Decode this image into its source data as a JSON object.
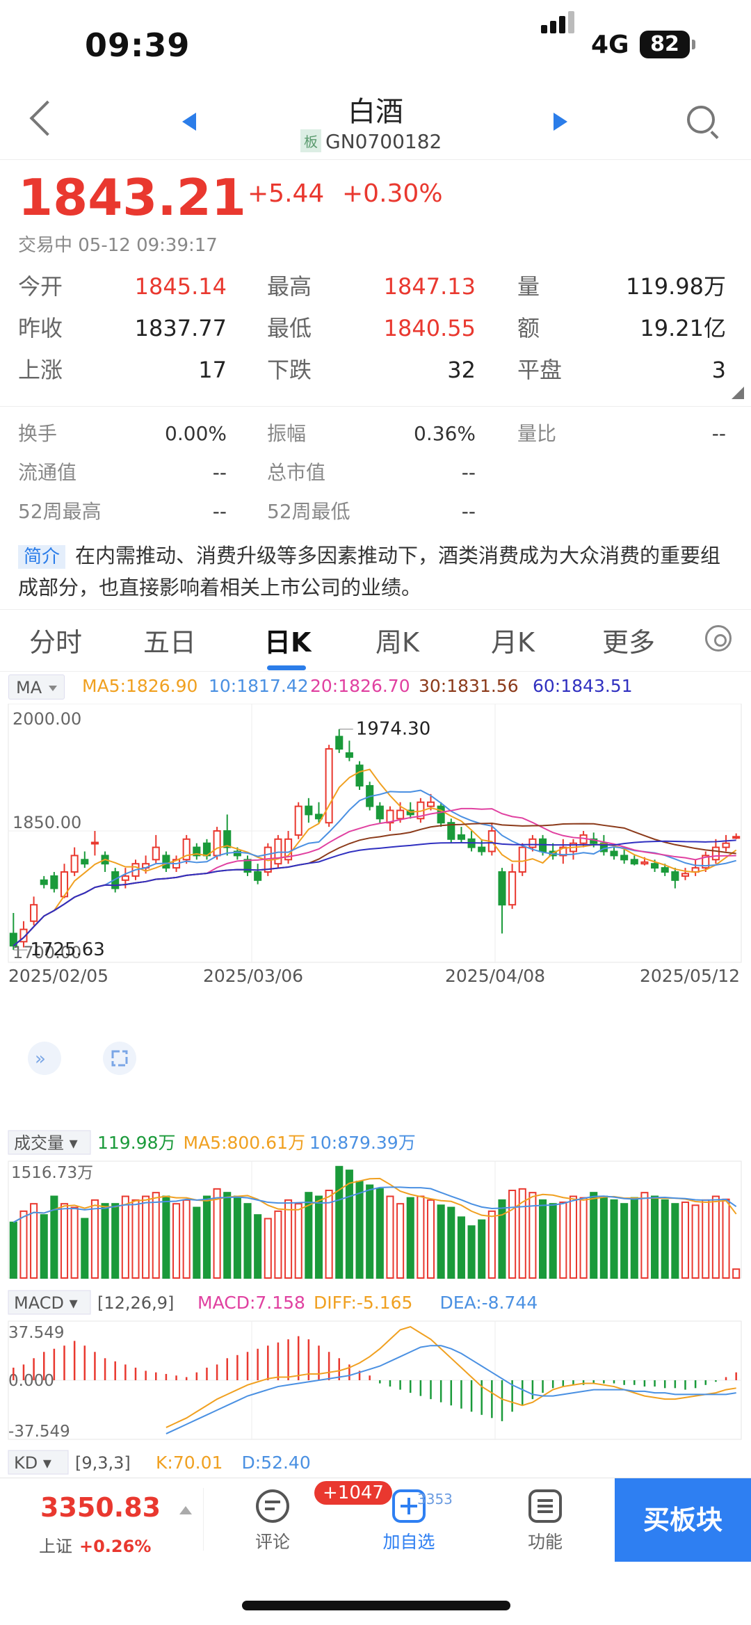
{
  "status_bar": {
    "time": "09:39",
    "network": "4G",
    "battery": "82"
  },
  "nav": {
    "title": "白酒",
    "tag": "板",
    "code": "GN0700182"
  },
  "quote": {
    "price": "1843.21",
    "change": "+5.44",
    "change_pct": "+0.30%",
    "trade_status": "交易中 05-12 09:39:17",
    "rows": [
      [
        {
          "label": "今开",
          "value": "1845.14",
          "red": true
        },
        {
          "label": "最高",
          "value": "1847.13",
          "red": true
        },
        {
          "label": "量",
          "value": "119.98万",
          "red": false
        }
      ],
      [
        {
          "label": "昨收",
          "value": "1837.77",
          "red": false
        },
        {
          "label": "最低",
          "value": "1840.55",
          "red": true
        },
        {
          "label": "额",
          "value": "19.21亿",
          "red": false
        }
      ],
      [
        {
          "label": "上涨",
          "value": "17",
          "red": false
        },
        {
          "label": "下跌",
          "value": "32",
          "red": false
        },
        {
          "label": "平盘",
          "value": "3",
          "red": false
        }
      ]
    ],
    "extra": [
      [
        {
          "label": "换手",
          "value": "0.00%"
        },
        {
          "label": "振幅",
          "value": "0.36%"
        },
        {
          "label": "量比",
          "value": "--"
        }
      ],
      [
        {
          "label": "流通值",
          "value": "--"
        },
        {
          "label": "总市值",
          "value": "--"
        },
        null
      ],
      [
        {
          "label": "52周最高",
          "value": "--"
        },
        {
          "label": "52周最低",
          "value": "--"
        },
        null
      ]
    ]
  },
  "intro": {
    "tag": "简介",
    "text": "在内需推动、消费升级等多因素推动下，酒类消费成为大众消费的重要组成部分，也直接影响着相关上市公司的业绩。"
  },
  "tabs": [
    "分时",
    "五日",
    "日K",
    "周K",
    "月K",
    "更多"
  ],
  "active_tab": "日K",
  "ma_legend": {
    "selector": "MA",
    "items": [
      {
        "text": "MA5:1826.90",
        "color": "#f0a020"
      },
      {
        "text": "10:1817.42",
        "color": "#4a90e2"
      },
      {
        "text": "20:1826.70",
        "color": "#e040a0"
      },
      {
        "text": "30:1831.56",
        "color": "#8b3a1a"
      },
      {
        "text": "60:1843.51",
        "color": "#3030c0"
      }
    ]
  },
  "volume_legend": {
    "selector": "成交量",
    "items": [
      {
        "text": "119.98万",
        "color": "#1a9a3a"
      },
      {
        "text": "MA5:800.61万",
        "color": "#f0a020"
      },
      {
        "text": "10:879.39万",
        "color": "#4a90e2"
      }
    ]
  },
  "macd_legend": {
    "selector": "MACD",
    "params": "[12,26,9]",
    "items": [
      {
        "text": "MACD:7.158",
        "color": "#e040a0"
      },
      {
        "text": "DIFF:-5.165",
        "color": "#f0a020"
      },
      {
        "text": "DEA:-8.744",
        "color": "#4a90e2"
      }
    ]
  },
  "kd_legend": {
    "selector": "KD",
    "params": "[9,3,3]",
    "items": [
      {
        "text": "K:70.01",
        "color": "#f0a020"
      },
      {
        "text": "D:52.40",
        "color": "#4a90e2"
      }
    ]
  },
  "chart_data": {
    "type": "candlestick",
    "price_axis": {
      "top": "2000.00",
      "mid": "1850.00",
      "bottom": "1700.00",
      "ylim": [
        1700,
        2000
      ]
    },
    "date_labels": [
      "2025/02/05",
      "2025/03/06",
      "2025/04/08",
      "2025/05/12"
    ],
    "annotations": {
      "high": "1974.30",
      "low": "1725.63"
    },
    "candles": [
      [
        1725,
        1710,
        1750,
        1705
      ],
      [
        1715,
        1730,
        1740,
        1708
      ],
      [
        1740,
        1760,
        1770,
        1735
      ],
      [
        1790,
        1785,
        1795,
        1780
      ],
      [
        1795,
        1780,
        1800,
        1775
      ],
      [
        1770,
        1800,
        1810,
        1768
      ],
      [
        1800,
        1820,
        1830,
        1795
      ],
      [
        1815,
        1810,
        1825,
        1805
      ],
      [
        1835,
        1836,
        1850,
        1820
      ],
      [
        1820,
        1810,
        1825,
        1800
      ],
      [
        1800,
        1780,
        1805,
        1775
      ],
      [
        1790,
        1795,
        1805,
        1780
      ],
      [
        1795,
        1810,
        1815,
        1790
      ],
      [
        1805,
        1810,
        1820,
        1798
      ],
      [
        1815,
        1830,
        1845,
        1810
      ],
      [
        1820,
        1805,
        1825,
        1800
      ],
      [
        1805,
        1815,
        1820,
        1800
      ],
      [
        1815,
        1840,
        1845,
        1810
      ],
      [
        1830,
        1820,
        1835,
        1815
      ],
      [
        1835,
        1820,
        1840,
        1815
      ],
      [
        1820,
        1850,
        1855,
        1815
      ],
      [
        1850,
        1830,
        1870,
        1820
      ],
      [
        1825,
        1820,
        1830,
        1815
      ],
      [
        1815,
        1800,
        1820,
        1795
      ],
      [
        1800,
        1790,
        1810,
        1785
      ],
      [
        1800,
        1830,
        1835,
        1795
      ],
      [
        1810,
        1840,
        1845,
        1805
      ],
      [
        1815,
        1840,
        1850,
        1810
      ],
      [
        1845,
        1880,
        1885,
        1840
      ],
      [
        1880,
        1870,
        1890,
        1860
      ],
      [
        1870,
        1865,
        1885,
        1860
      ],
      [
        1860,
        1950,
        1955,
        1855
      ],
      [
        1965,
        1950,
        1974,
        1945
      ],
      [
        1945,
        1940,
        1960,
        1935
      ],
      [
        1930,
        1905,
        1935,
        1900
      ],
      [
        1905,
        1880,
        1910,
        1875
      ],
      [
        1880,
        1865,
        1885,
        1860
      ],
      [
        1860,
        1875,
        1880,
        1850
      ],
      [
        1865,
        1875,
        1885,
        1860
      ],
      [
        1875,
        1870,
        1885,
        1865
      ],
      [
        1865,
        1885,
        1890,
        1860
      ],
      [
        1880,
        1885,
        1895,
        1875
      ],
      [
        1880,
        1860,
        1885,
        1855
      ],
      [
        1860,
        1840,
        1865,
        1835
      ],
      [
        1845,
        1840,
        1855,
        1835
      ],
      [
        1840,
        1830,
        1850,
        1825
      ],
      [
        1830,
        1825,
        1840,
        1820
      ],
      [
        1825,
        1850,
        1860,
        1820
      ],
      [
        1800,
        1760,
        1805,
        1725
      ],
      [
        1760,
        1800,
        1810,
        1755
      ],
      [
        1800,
        1830,
        1835,
        1795
      ],
      [
        1830,
        1840,
        1845,
        1825
      ],
      [
        1840,
        1825,
        1845,
        1820
      ],
      [
        1825,
        1820,
        1835,
        1815
      ],
      [
        1820,
        1830,
        1840,
        1810
      ],
      [
        1825,
        1835,
        1840,
        1815
      ],
      [
        1835,
        1845,
        1850,
        1830
      ],
      [
        1840,
        1835,
        1848,
        1830
      ],
      [
        1835,
        1825,
        1845,
        1820
      ],
      [
        1825,
        1820,
        1830,
        1815
      ],
      [
        1820,
        1815,
        1828,
        1810
      ],
      [
        1815,
        1810,
        1820,
        1808
      ],
      [
        1810,
        1812,
        1818,
        1808
      ],
      [
        1810,
        1805,
        1815,
        1800
      ],
      [
        1805,
        1800,
        1810,
        1795
      ],
      [
        1800,
        1790,
        1805,
        1780
      ],
      [
        1795,
        1798,
        1805,
        1790
      ],
      [
        1800,
        1805,
        1815,
        1795
      ],
      [
        1805,
        1820,
        1825,
        1800
      ],
      [
        1815,
        1830,
        1840,
        1810
      ],
      [
        1830,
        1835,
        1845,
        1825
      ],
      [
        1842,
        1843,
        1847,
        1840
      ]
    ],
    "volume_axis": {
      "top": "1516.73万",
      "max": 1516.73
    },
    "volume": [
      750,
      900,
      1000,
      850,
      1100,
      1000,
      950,
      800,
      1050,
      1000,
      1000,
      1100,
      1050,
      1100,
      1150,
      1100,
      1000,
      1050,
      950,
      1100,
      1200,
      1150,
      1100,
      1000,
      850,
      800,
      900,
      1050,
      1000,
      1150,
      1100,
      1180,
      1500,
      1450,
      1300,
      1250,
      1200,
      1100,
      1000,
      1080,
      1100,
      1050,
      980,
      950,
      820,
      700,
      780,
      900,
      1050,
      1180,
      1200,
      1150,
      1050,
      1000,
      1020,
      1100,
      1080,
      1150,
      1100,
      1050,
      1000,
      1080,
      1150,
      1100,
      1050,
      1000,
      1020,
      980,
      1050,
      1100,
      1060,
      120
    ],
    "macd_axis": {
      "top": "37.549",
      "mid": "0.000",
      "bottom": "-37.549",
      "ylim": [
        -37.549,
        37.549
      ]
    },
    "macd": [
      8,
      10,
      14,
      18,
      20,
      22,
      25,
      22,
      18,
      14,
      12,
      10,
      8,
      6,
      5,
      4,
      3,
      2,
      5,
      8,
      10,
      14,
      16,
      18,
      20,
      22,
      24,
      26,
      28,
      26,
      22,
      18,
      14,
      10,
      6,
      3,
      -2,
      -4,
      -6,
      -8,
      -10,
      -12,
      -14,
      -16,
      -18,
      -20,
      -22,
      -24,
      -26,
      -20,
      -16,
      -12,
      -8,
      -5,
      -4,
      -3,
      -3,
      -2,
      -2,
      -2,
      -3,
      -3,
      -4,
      -4,
      -5,
      -5,
      -6,
      -5,
      -3,
      -1,
      2,
      5
    ],
    "diff": [
      -30,
      -27,
      -24,
      -20,
      -16,
      -12,
      -9,
      -6,
      -3,
      -1,
      1,
      2,
      2,
      3,
      4,
      4,
      5,
      6,
      8,
      11,
      15,
      20,
      26,
      32,
      34,
      30,
      26,
      20,
      14,
      8,
      2,
      -4,
      -8,
      -12,
      -14,
      -16,
      -14,
      -10,
      -6,
      -4,
      -3,
      -2,
      -2,
      -3,
      -4,
      -6,
      -8,
      -10,
      -11,
      -12,
      -12,
      -11,
      -10,
      -9,
      -8,
      -6,
      -5
    ],
    "dea": [
      -34,
      -31,
      -28,
      -25,
      -22,
      -19,
      -16,
      -13,
      -10,
      -8,
      -6,
      -4,
      -3,
      -2,
      -1,
      0,
      1,
      2,
      3,
      5,
      7,
      9,
      12,
      15,
      18,
      21,
      22,
      22,
      20,
      17,
      13,
      9,
      5,
      1,
      -3,
      -6,
      -9,
      -10,
      -10,
      -9,
      -8,
      -7,
      -6,
      -6,
      -6,
      -6,
      -7,
      -7,
      -8,
      -8,
      -9,
      -9,
      -9,
      -9,
      -9,
      -9,
      -8
    ]
  },
  "bottom": {
    "index_value": "3350.83",
    "index_name": "上证",
    "index_change": "+0.26%",
    "comment_label": "评论",
    "comment_badge": "+1047",
    "watch_label": "加自选",
    "watch_count": "3353",
    "func_label": "功能",
    "buy_label": "买板块"
  }
}
